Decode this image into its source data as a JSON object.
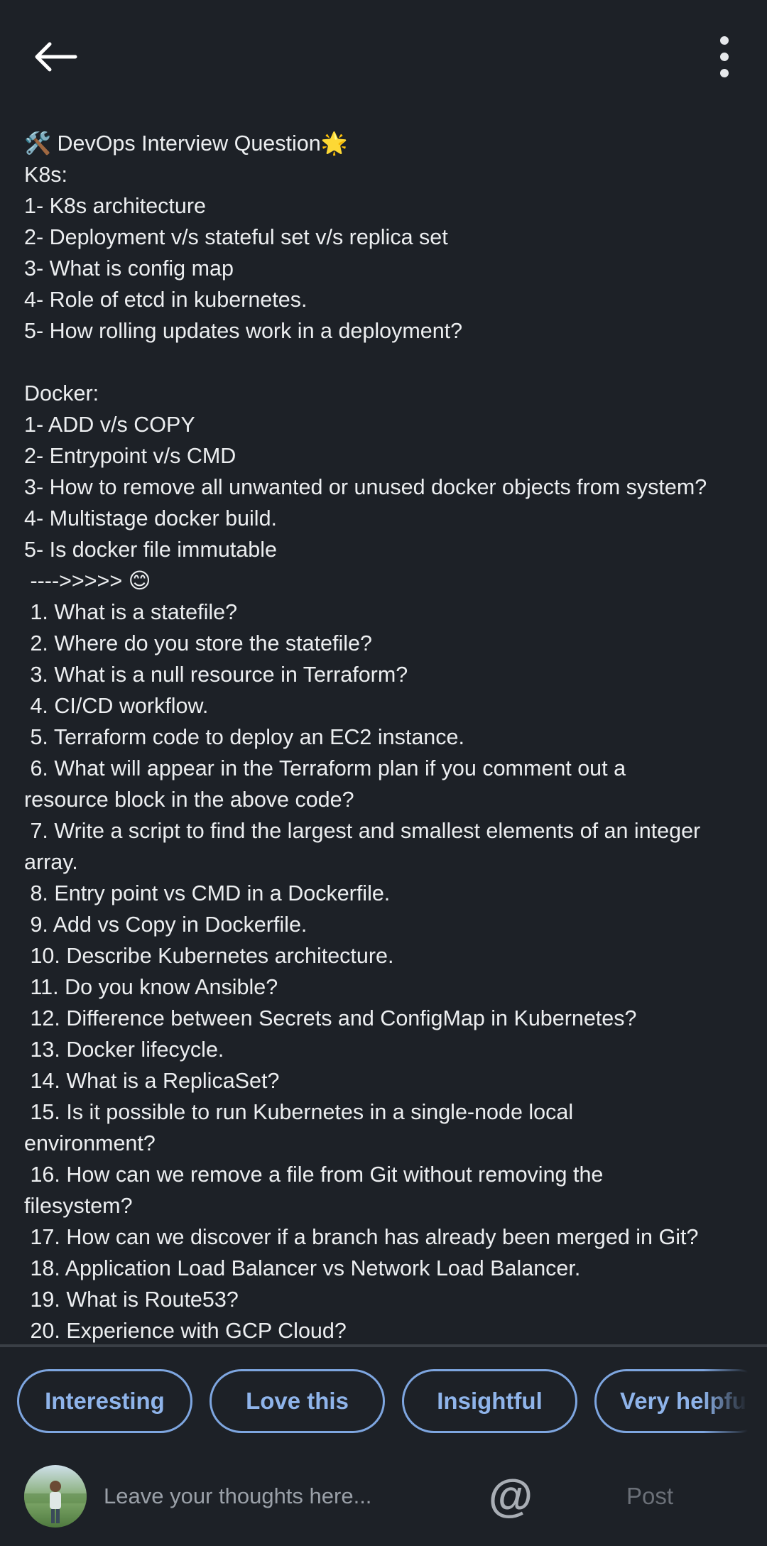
{
  "header": {
    "back_icon": "arrow-left-icon",
    "menu_icon": "more-vertical-icon"
  },
  "post": {
    "lines": [
      "🛠️ DevOps Interview Question🌟",
      "K8s:",
      "1- K8s architecture",
      "2- Deployment v/s stateful set v/s replica set",
      "3- What is config map",
      "4- Role of etcd in kubernetes.",
      "5- How rolling updates work in a deployment?",
      "",
      "Docker:",
      "1- ADD v/s COPY",
      "2- Entrypoint v/s CMD",
      "3- How to remove all unwanted or unused docker objects from system?",
      "4- Multistage docker build.",
      "5- Is docker file immutable",
      " ---->>>>> 😊",
      " 1. What is a statefile?",
      " 2. Where do you store the statefile?",
      " 3. What is a null resource in Terraform?",
      " 4. CI/CD workflow.",
      " 5. Terraform code to deploy an EC2 instance.",
      " 6. What will appear in the Terraform plan if you comment out a",
      "resource block in the above code?",
      " 7. Write a script to find the largest and smallest elements of an integer",
      "array.",
      " 8. Entry point vs CMD in a Dockerfile.",
      " 9. Add vs Copy in Dockerfile.",
      " 10. Describe Kubernetes architecture.",
      " 11. Do you know Ansible?",
      " 12. Difference between Secrets and ConfigMap in Kubernetes?",
      " 13. Docker lifecycle.",
      " 14. What is a ReplicaSet?",
      " 15. Is it possible to run Kubernetes in a single-node local",
      "environment?",
      " 16. How can we remove a file from Git without removing the",
      "filesystem?",
      " 17. How can we discover if a branch has already been merged in Git?",
      " 18. Application Load Balancer vs Network Load Balancer.",
      " 19. What is Route53?",
      " 20. Experience with GCP Cloud?"
    ]
  },
  "reactions": {
    "chips": [
      "Interesting",
      "Love this",
      "Insightful",
      "Very helpfu"
    ]
  },
  "composer": {
    "avatar_icon": "user-avatar",
    "placeholder": "Leave your thoughts here...",
    "mention_symbol": "@",
    "post_label": "Post"
  },
  "colors": {
    "background": "#1d2127",
    "accent": "#8fb4ea",
    "text": "#eceef0",
    "muted": "#9aa0a8"
  }
}
